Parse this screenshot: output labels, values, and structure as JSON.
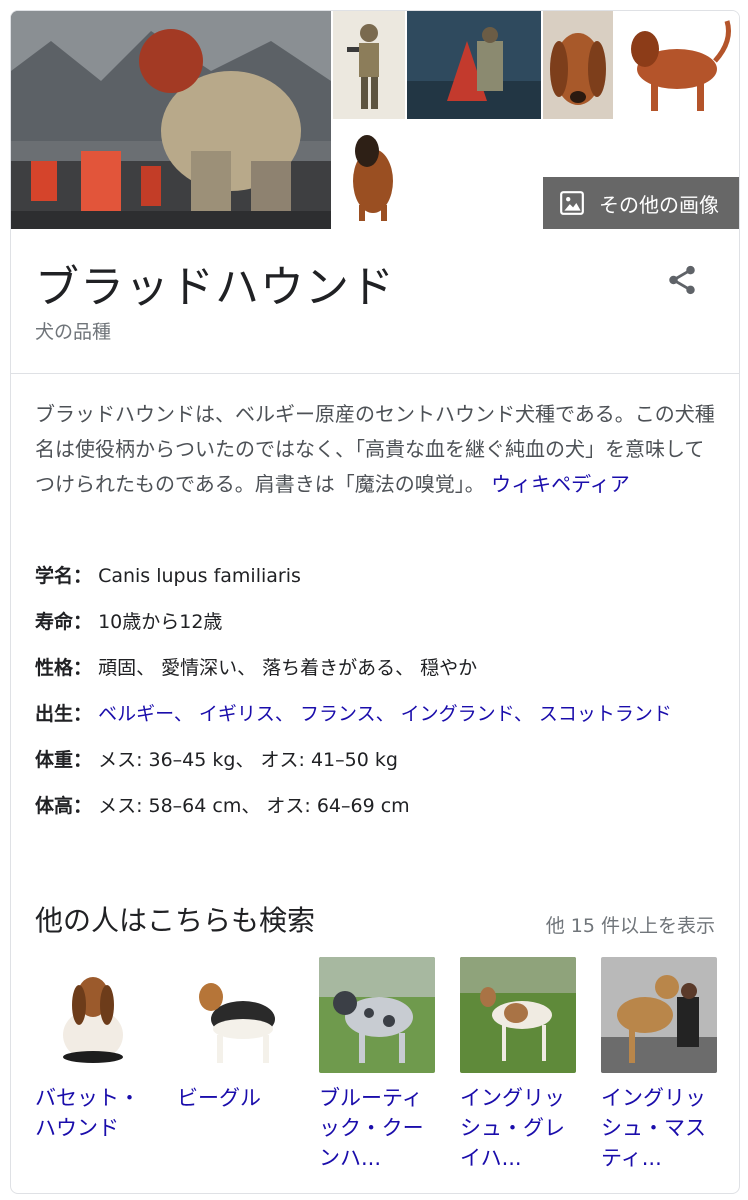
{
  "header": {
    "more_images_label": "その他の画像"
  },
  "entity": {
    "title": "ブラッドハウンド",
    "subtitle": "犬の品種"
  },
  "description": {
    "text": "ブラッドハウンドは、ベルギー原産のセントハウンド犬種である。この犬種名は使役柄からついたのではなく、「高貴な血を継ぐ純血の犬」を意味してつけられたものである。肩書きは「魔法の嗅覚」。",
    "source_link": "ウィキペディア"
  },
  "facts": [
    {
      "label": "学名：",
      "value": "Canis lupus familiaris"
    },
    {
      "label": "寿命：",
      "value": "10歳から12歳"
    },
    {
      "label": "性格：",
      "value": "頑固、 愛情深い、 落ち着きがある、 穏やか"
    },
    {
      "label": "出生：",
      "value": "ベルギー、 イギリス、 フランス、 イングランド、 スコットランド"
    },
    {
      "label": "体重：",
      "value": "メス: 36–45 kg、 オス: 41–50 kg"
    },
    {
      "label": "体高：",
      "value": "メス: 58–64 cm、 オス: 64–69 cm"
    }
  ],
  "also_search": {
    "title": "他の人はこちらも検索",
    "more_label": "他 15 件以上を表示",
    "items": [
      {
        "label": "バセット・ハウンド"
      },
      {
        "label": "ビーグル"
      },
      {
        "label": "ブルーティック・クーンハ..."
      },
      {
        "label": "イングリッシュ・グレイハ..."
      },
      {
        "label": "イングリッシュ・マスティ..."
      }
    ]
  },
  "colors": {
    "link": "#1a0dab",
    "muted": "#70757a",
    "border": "#dfe1e5"
  },
  "icons": {
    "more_images": "image-icon",
    "share": "share-icon"
  }
}
